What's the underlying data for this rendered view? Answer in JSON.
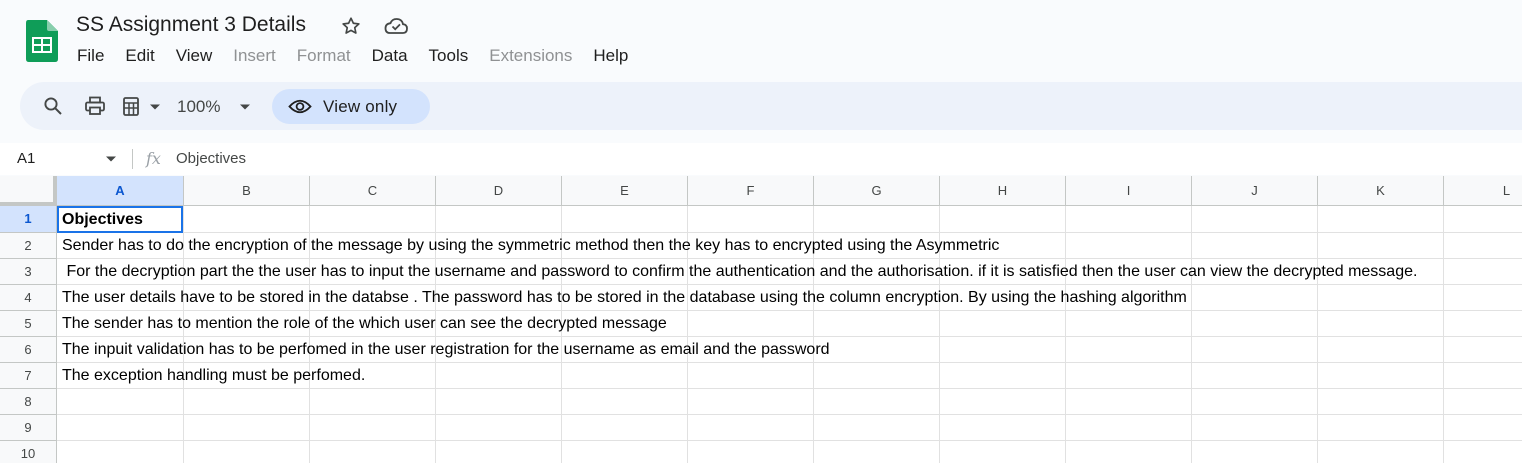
{
  "app": {
    "title": "SS Assignment 3 Details",
    "accent_color": "#0b57d0",
    "logo_color": "#0f9d58"
  },
  "menu": [
    {
      "label": "File",
      "enabled": true
    },
    {
      "label": "Edit",
      "enabled": true
    },
    {
      "label": "View",
      "enabled": true
    },
    {
      "label": "Insert",
      "enabled": false
    },
    {
      "label": "Format",
      "enabled": false
    },
    {
      "label": "Data",
      "enabled": true
    },
    {
      "label": "Tools",
      "enabled": true
    },
    {
      "label": "Extensions",
      "enabled": false
    },
    {
      "label": "Help",
      "enabled": true
    }
  ],
  "toolbar": {
    "icons": [
      "search-icon",
      "print-icon",
      "paint-format-icon",
      "chevron-down-icon"
    ],
    "zoom": "100%",
    "view_only_label": "View only"
  },
  "formula_bar": {
    "name_box": "A1",
    "fx": "fx",
    "content": "Objectives"
  },
  "grid": {
    "columns": [
      "A",
      "B",
      "C",
      "D",
      "E",
      "F",
      "G",
      "H",
      "I",
      "J",
      "K",
      "L"
    ],
    "selected_column": "A",
    "selected_row": "1",
    "rows": [
      {
        "num": "1",
        "text": "Objectives"
      },
      {
        "num": "2",
        "text": "Sender has to do the encryption of the message by using the symmetric method then the key has to encrypted using the Asymmetric"
      },
      {
        "num": "3",
        "text": " For the decryption part the the user has to input the username and password to confirm the authentication and the authorisation. if it is satisfied then the user can view the decrypted message."
      },
      {
        "num": "4",
        "text": "The user details have to be stored in the databse . The password has to be stored in the database using the column encryption. By using the hashing algorithm"
      },
      {
        "num": "5",
        "text": "The sender has to mention the role of the which user can see the decrypted message"
      },
      {
        "num": "6",
        "text": "The inpuit validation has to be perfomed in the user registration for the username as email and the password"
      },
      {
        "num": "7",
        "text": "The exception handling must be perfomed."
      },
      {
        "num": "8",
        "text": ""
      },
      {
        "num": "9",
        "text": ""
      },
      {
        "num": "10",
        "text": ""
      }
    ]
  }
}
